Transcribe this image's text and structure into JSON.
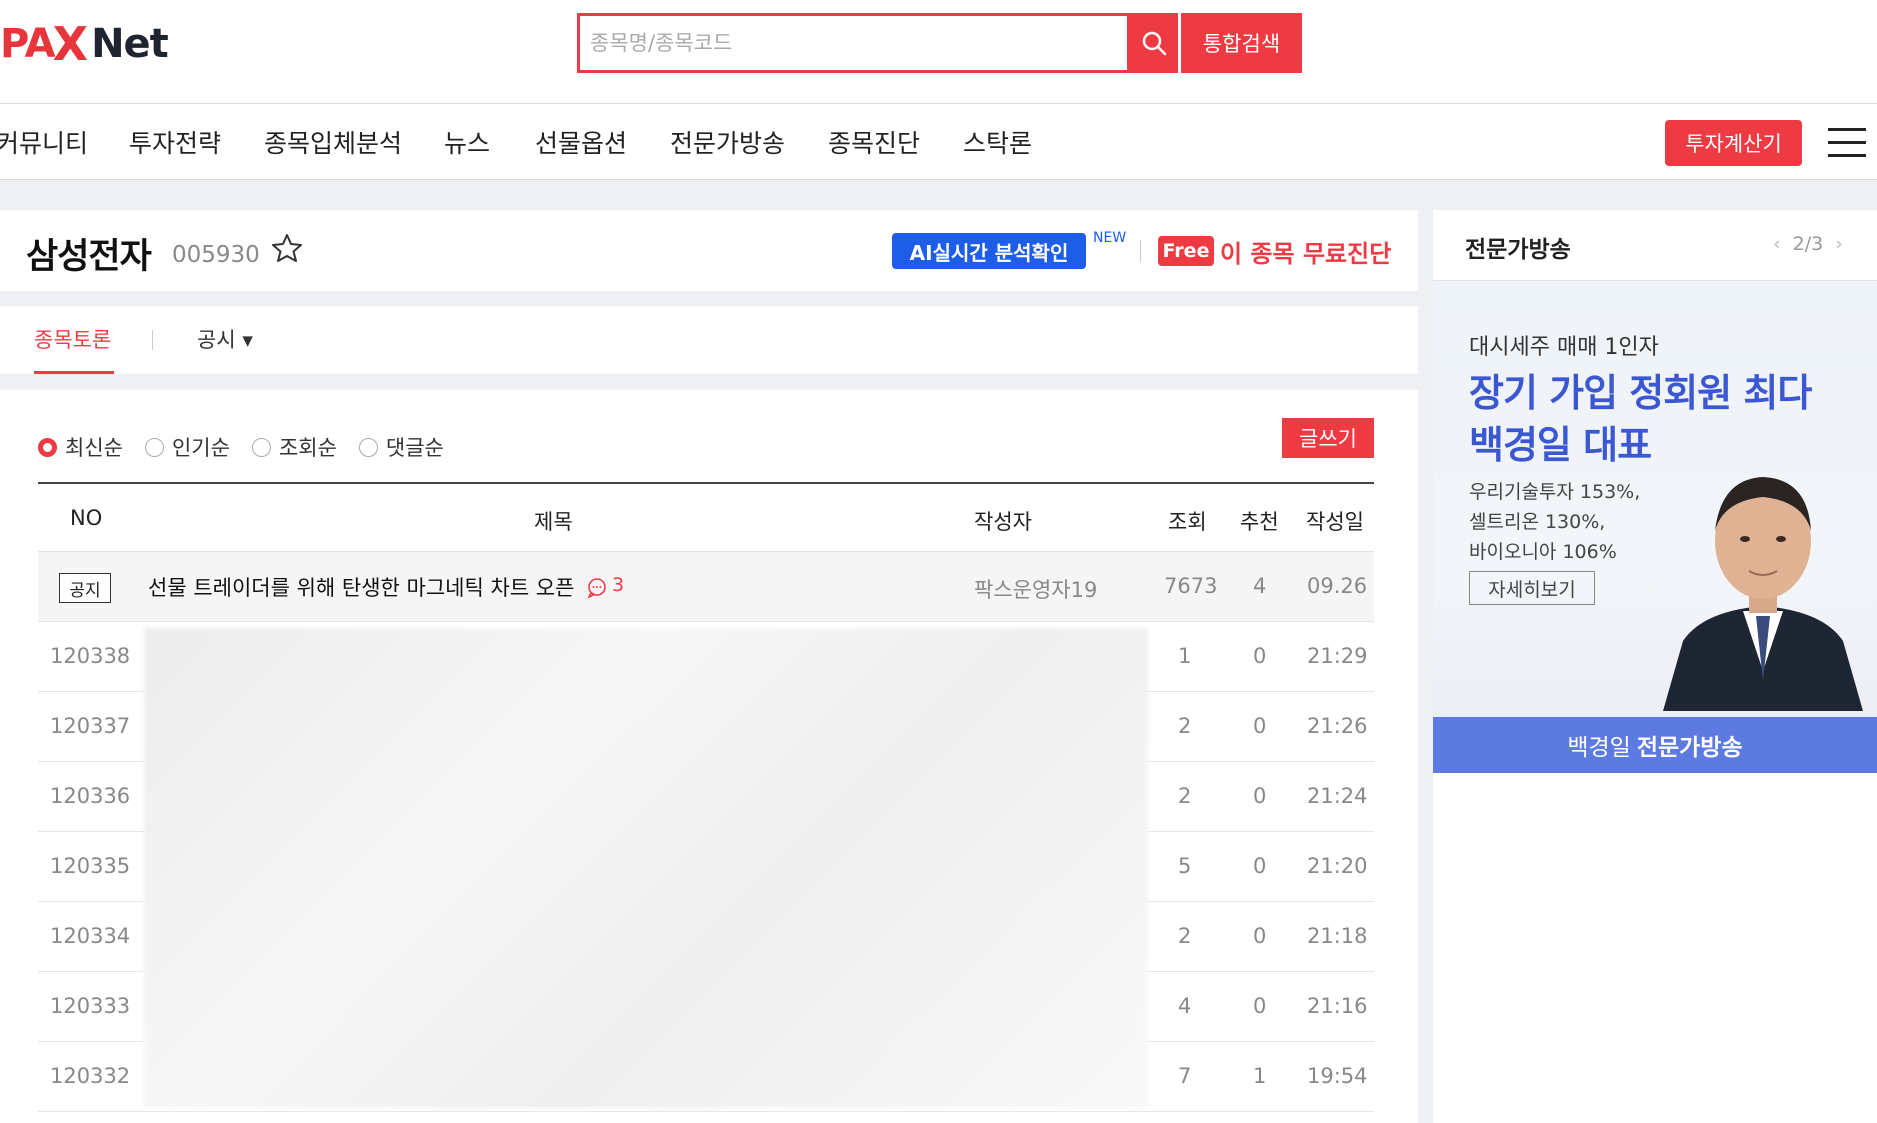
{
  "header": {
    "logo": {
      "pa": "PA",
      "x": "X",
      "net": "Net"
    },
    "search_placeholder": "종목명/종목코드",
    "total_search": "통합검색"
  },
  "nav": {
    "items": [
      "커뮤니티",
      "투자전략",
      "종목입체분석",
      "뉴스",
      "선물옵션",
      "전문가방송",
      "종목진단",
      "스탁론"
    ],
    "calc_button": "투자계산기"
  },
  "stock": {
    "name": "삼성전자",
    "code": "005930",
    "ai_badge": "AI실시간 분석확인",
    "new_tag": "NEW",
    "free_tag": "Free",
    "free_text": "이 종목 무료진단"
  },
  "tabs": {
    "active": "종목토론",
    "notice": "공시 ▾"
  },
  "list": {
    "sort_options": [
      "최신순",
      "인기순",
      "조회순",
      "댓글순"
    ],
    "write_button": "글쓰기",
    "columns": [
      "NO",
      "제목",
      "작성자",
      "조회",
      "추천",
      "작성일"
    ],
    "notice_row": {
      "badge": "공지",
      "title": "선물 트레이더를 위해 탄생한 마그네틱 차트 오픈",
      "comments": "3",
      "author": "팍스운영자19",
      "views": "7673",
      "likes": "4",
      "date": "09.26"
    },
    "rows": [
      {
        "no": "120338",
        "views": "1",
        "likes": "0",
        "date": "21:29"
      },
      {
        "no": "120337",
        "views": "2",
        "likes": "0",
        "date": "21:26"
      },
      {
        "no": "120336",
        "views": "2",
        "likes": "0",
        "date": "21:24"
      },
      {
        "no": "120335",
        "views": "5",
        "likes": "0",
        "date": "21:20"
      },
      {
        "no": "120334",
        "views": "2",
        "likes": "0",
        "date": "21:18"
      },
      {
        "no": "120333",
        "views": "4",
        "likes": "0",
        "date": "21:16"
      },
      {
        "no": "120332",
        "views": "7",
        "likes": "1",
        "date": "19:54"
      }
    ]
  },
  "side": {
    "title": "전문가방송",
    "pager": "2/3",
    "ad": {
      "sub": "대시세주 매매 1인자",
      "head_1": "장기 가입 정회원 최다",
      "head_2": "백경일 대표",
      "stats": [
        "우리기술투자 153%,",
        "셀트리온 130%,",
        "바이오니아 106%"
      ],
      "more": "자세히보기",
      "footer_name": "백경일",
      "footer_label": "전문가방송"
    }
  },
  "colors": {
    "accent": "#ee3b43",
    "ai_blue": "#1e5de8",
    "ad_blue": "#3b57d1"
  }
}
